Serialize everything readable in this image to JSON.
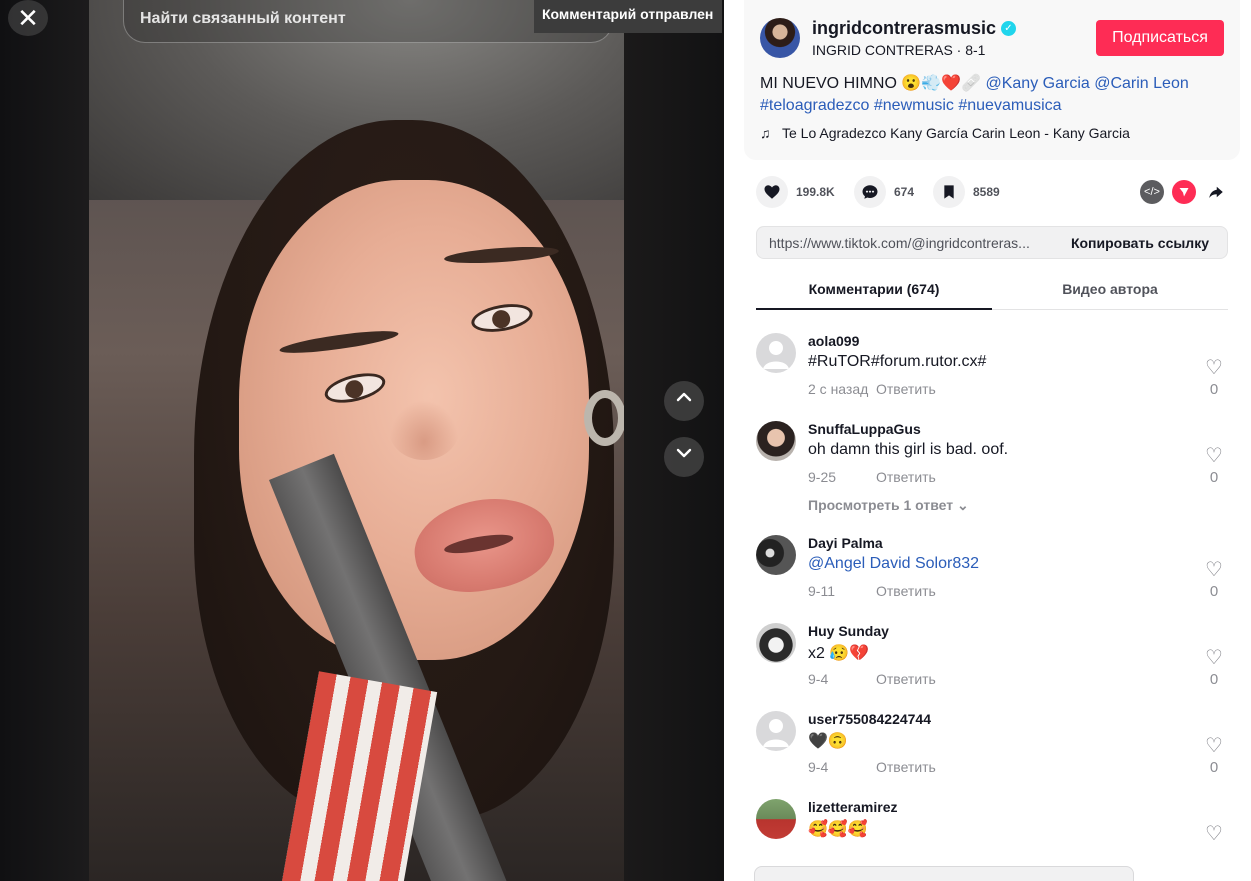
{
  "overlay": {
    "close_icon": "close-icon",
    "search_text": "Найти связанный контент",
    "toast": "Комментарий отправлен",
    "nav_up_icon": "chevron-up-icon",
    "nav_down_icon": "chevron-down-icon"
  },
  "author": {
    "username": "ingridcontrerasmusic",
    "display": "INGRID CONTRERAS · 8-1",
    "follow_label": "Подписаться"
  },
  "description": {
    "text": "MI NUEVO HIMNO 😮💨❤️🩹",
    "mentions": [
      "@Kany Garcia",
      "@Carin Leon"
    ],
    "hashtags": [
      "#teloagradezco",
      "#newmusic",
      "#nuevamusica"
    ]
  },
  "music": {
    "icon": "music-note-icon",
    "title": "Te Lo Agradezco Kany García Carin Leon - Kany Garcia"
  },
  "stats": {
    "likes": "199.8K",
    "comments": "674",
    "saves": "8589"
  },
  "link": {
    "url": "https://www.tiktok.com/@ingridcontreras...",
    "copy_label": "Копировать ссылку"
  },
  "tabs": [
    {
      "label": "Комментарии (674)"
    },
    {
      "label": "Видео автора"
    }
  ],
  "comments": [
    {
      "user": "aola099",
      "text": "#RuTOR#forum.rutor.cx#",
      "date": "2 с назад",
      "reply": "Ответить",
      "likes": "0"
    },
    {
      "user": "SnuffaLuppaGus",
      "text": "oh damn this girl is bad. oof.",
      "date": "9-25",
      "reply": "Ответить",
      "likes": "0",
      "view_replies": "Просмотреть 1 ответ"
    },
    {
      "user": "Dayi Palma",
      "text": "@Angel David Solor832",
      "date": "9-11",
      "reply": "Ответить",
      "likes": "0"
    },
    {
      "user": "Huy Sunday",
      "text": "x2 😥💔",
      "date": "9-4",
      "reply": "Ответить",
      "likes": "0"
    },
    {
      "user": "user755084224744",
      "text": "🖤🙃",
      "date": "9-4",
      "reply": "Ответить",
      "likes": "0"
    },
    {
      "user": "lizetteramirez",
      "text": "🥰🥰🥰",
      "date": "",
      "reply": "",
      "likes": ""
    }
  ],
  "colors": {
    "accent": "#fe2c55",
    "link": "#2b5db9",
    "verified": "#20d5ec"
  }
}
